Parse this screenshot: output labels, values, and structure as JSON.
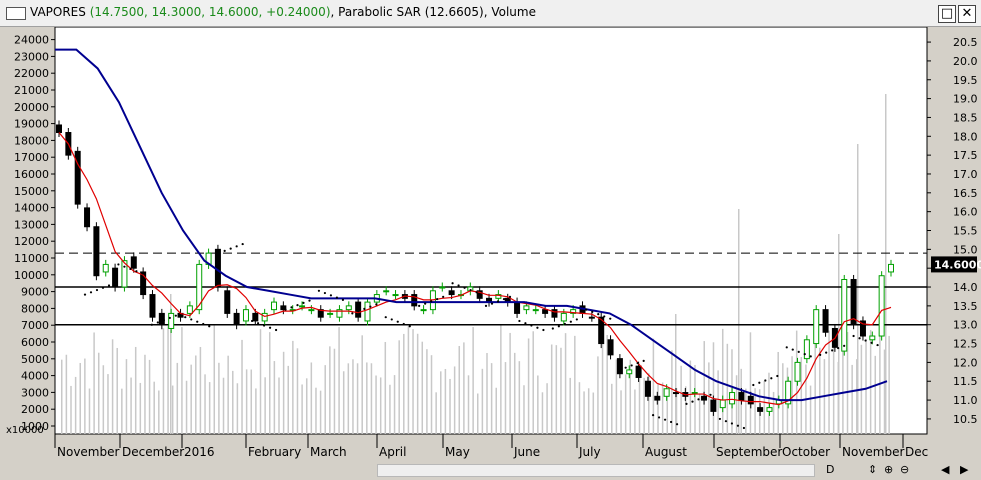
{
  "window": {
    "symbol": "VAPORES",
    "quote": "(14.7500, 14.3000, 14.6000, +0.24000)",
    "indicators": "Parabolic SAR (12.6605), Volume",
    "maximize_icon": "maximize-icon",
    "close_icon": "close-icon"
  },
  "colors": {
    "up_candle": "#00a000",
    "down_candle": "#000000",
    "ma_short": "#e00000",
    "ma_long": "#000090",
    "sar": "#000000",
    "volume": "#c8c8c8",
    "background": "#ffffff",
    "last_price_box": "#000000"
  },
  "chart_data": {
    "type": "candlestick",
    "price_axis": {
      "ticks": [
        "10.5",
        "11.0",
        "11.5",
        "12.0",
        "12.5",
        "13.0",
        "13.5",
        "14.0",
        "14.5",
        "15.0",
        "15.5",
        "16.0",
        "16.5",
        "17.0",
        "17.5",
        "18.0",
        "18.5",
        "19.0",
        "19.5",
        "20.0",
        "20.5"
      ],
      "range": [
        10.1,
        20.9
      ]
    },
    "volume_axis": {
      "ticks": [
        "1000",
        "2000",
        "3000",
        "4000",
        "5000",
        "6000",
        "7000",
        "8000",
        "9000",
        "10000",
        "11000",
        "12000",
        "13000",
        "14000",
        "15000",
        "16000",
        "17000",
        "18000",
        "19000",
        "20000",
        "21000",
        "22000",
        "23000",
        "24000"
      ],
      "multiplier": "x10000"
    },
    "x_labels": [
      "November",
      "December",
      "2016",
      "February",
      "March",
      "April",
      "May",
      "June",
      "July",
      "August",
      "September",
      "October",
      "November",
      "Dec"
    ],
    "last_price": "14.6000",
    "horizontal_lines": [
      {
        "value": 14.0,
        "style": "solid"
      },
      {
        "value": 13.0,
        "style": "solid"
      },
      {
        "value": 14.9,
        "style": "dashed"
      }
    ],
    "close_series": [
      18.1,
      17.5,
      16.2,
      15.6,
      14.3,
      14.6,
      14.0,
      14.7,
      14.5,
      13.8,
      13.2,
      13.0,
      13.3,
      13.2,
      13.5,
      14.6,
      14.9,
      14.0,
      13.3,
      13.0,
      13.4,
      13.1,
      13.3,
      13.6,
      13.4,
      13.4,
      13.5,
      13.4,
      13.2,
      13.3,
      13.4,
      13.5,
      13.2,
      13.6,
      13.8,
      13.9,
      13.8,
      13.7,
      13.5,
      13.4,
      13.9,
      14.0,
      13.8,
      13.8,
      14.0,
      13.7,
      13.6,
      13.8,
      13.6,
      13.3,
      13.5,
      13.4,
      13.3,
      13.2,
      13.3,
      13.4,
      13.3,
      13.2,
      12.5,
      12.2,
      11.7,
      11.8,
      11.6,
      11.1,
      11.0,
      11.3,
      11.2,
      11.1,
      11.2,
      11.0,
      10.7,
      11.0,
      11.2,
      11.0,
      10.9,
      10.7,
      10.8,
      11.0,
      11.5,
      12.0,
      12.6,
      13.4,
      12.8,
      12.4,
      14.2,
      13.0,
      12.7,
      12.7,
      14.3,
      14.6
    ],
    "ma_long_series": [
      20.3,
      20.3,
      19.8,
      18.9,
      17.7,
      16.5,
      15.5,
      14.7,
      14.3,
      14.0,
      13.9,
      13.8,
      13.7,
      13.7,
      13.7,
      13.7,
      13.6,
      13.6,
      13.6,
      13.6,
      13.6,
      13.6,
      13.6,
      13.5,
      13.5,
      13.4,
      13.3,
      13.0,
      12.6,
      12.2,
      11.8,
      11.5,
      11.3,
      11.1,
      11.0,
      11.0,
      11.1,
      11.2,
      11.3,
      11.5
    ],
    "sar_levels": [
      13.8,
      14.6,
      13.0,
      13.2,
      14.9,
      13.1,
      13.4,
      13.9,
      13.3,
      13.2,
      13.5,
      14.1,
      13.5,
      13.1,
      12.9,
      13.4,
      11.8,
      10.6,
      10.9,
      10.5,
      11.4,
      12.4,
      12.2,
      12.7
    ]
  },
  "bottom": {
    "left_arrow": "◀",
    "right_arrow": "▶",
    "zoom_buttons": [
      "D",
      "⇕",
      "⊕",
      "⊖"
    ]
  }
}
